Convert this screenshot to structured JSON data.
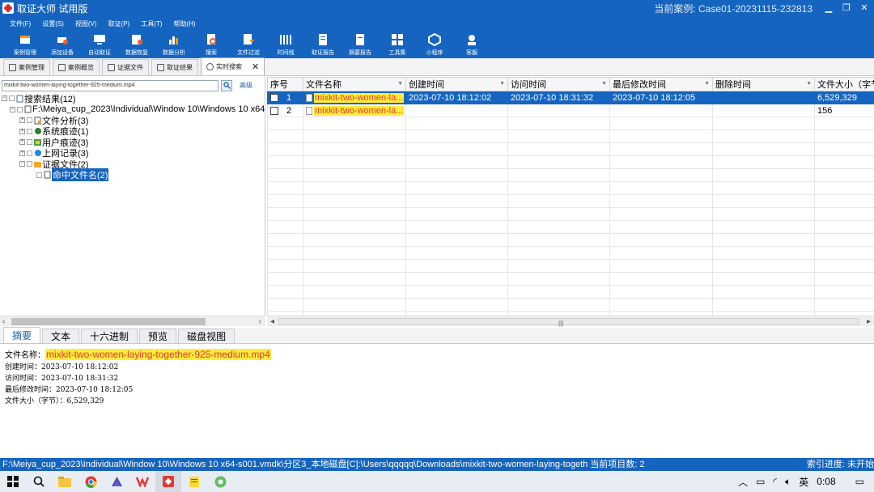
{
  "window": {
    "title": "取证大师 试用版",
    "case_label": "当前案例: Case01-20231115-232813",
    "min": "▁",
    "restore": "❐",
    "close": "✕"
  },
  "menu": [
    "文件(F)",
    "设置(S)",
    "视图(V)",
    "取证(P)",
    "工具(T)",
    "帮助(H)"
  ],
  "toolbar": [
    {
      "label": "案例管理",
      "icon": "case-management-icon"
    },
    {
      "label": "添加设备",
      "icon": "add-device-icon"
    },
    {
      "label": "自动取证",
      "icon": "auto-forensics-icon"
    },
    {
      "label": "数据恢复",
      "icon": "data-recovery-icon"
    },
    {
      "label": "数据分析",
      "icon": "data-analysis-icon"
    },
    {
      "label": "搜索",
      "icon": "search-icon"
    },
    {
      "label": "文件过滤",
      "icon": "file-filter-icon"
    },
    {
      "label": "时间线",
      "icon": "timeline-icon"
    },
    {
      "label": "取证报告",
      "icon": "forensic-report-icon"
    },
    {
      "label": "摘要报告",
      "icon": "summary-report-icon"
    },
    {
      "label": "工具集",
      "icon": "toolset-icon"
    },
    {
      "label": "小程序",
      "icon": "mini-program-icon"
    },
    {
      "label": "客服",
      "icon": "customer-service-icon"
    }
  ],
  "tabs": [
    "案例管理",
    "案例概览",
    "证据文件",
    "取证结果",
    "实时搜索"
  ],
  "search": {
    "value": "mixkit-two-women-laying-together-925-medium.mp4",
    "advanced": "高级"
  },
  "tree": {
    "root": "搜索结果(12)",
    "path": "F:\\Meiya_cup_2023\\Individual\\Window 10\\Windows 10 x64",
    "items": [
      "文件分析(3)",
      "系统痕迹(1)",
      "用户痕迹(3)",
      "上网记录(3)",
      "证据文件(2)"
    ],
    "selected": "命中文件名(2)"
  },
  "grid": {
    "columns": [
      "序号",
      "文件名称",
      "创建时间",
      "访问时间",
      "最后修改时间",
      "删除时间",
      "文件大小（字节）"
    ],
    "rows": [
      {
        "no": "1",
        "name": "mixkit-two-women-la...",
        "created": "2023-07-10 18:12:02",
        "accessed": "2023-07-10 18:31:32",
        "modified": "2023-07-10 18:12:05",
        "deleted": "",
        "size": "6,529,329"
      },
      {
        "no": "2",
        "name": "mixkit-two-women-la...",
        "created": "",
        "accessed": "",
        "modified": "",
        "deleted": "",
        "size": "156"
      }
    ]
  },
  "detail_tabs": [
    "摘要",
    "文本",
    "十六进制",
    "预览",
    "磁盘视图"
  ],
  "detail": {
    "filename_label": "文件名称：",
    "filename": "mixkit-two-women-laying-together-925-medium.mp4",
    "created": "创建时间：2023-07-10 18:12:02",
    "accessed": "访问时间：2023-07-10 18:31:32",
    "modified": "最后修改时间：2023-07-10 18:12:05",
    "size": "文件大小（字节）：6,529,329"
  },
  "status": {
    "path": "F:\\Meiya_cup_2023\\Individual\\Window 10\\Windows 10 x64-s001.vmdk\\分区3_本地磁盘[C]:\\Users\\qqqqq\\Downloads\\mixkit-two-women-laying-togeth 当前项目数: 2",
    "index": "索引进度: 未开始"
  },
  "taskbar": {
    "ime": "英",
    "clock": "0:08"
  }
}
